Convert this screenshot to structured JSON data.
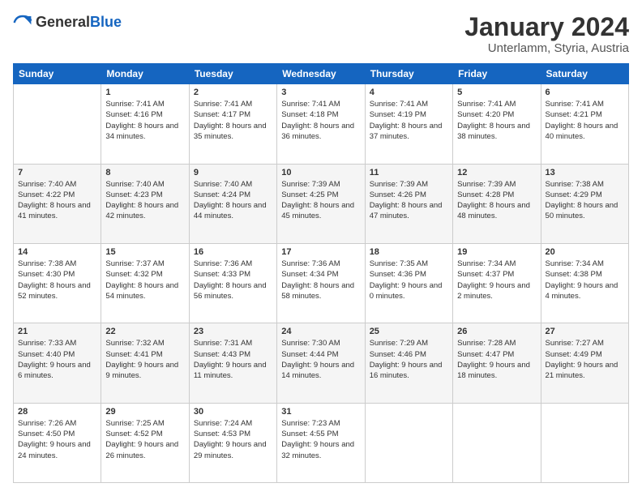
{
  "logo": {
    "general": "General",
    "blue": "Blue"
  },
  "header": {
    "title": "January 2024",
    "subtitle": "Unterlamm, Styria, Austria"
  },
  "weekdays": [
    "Sunday",
    "Monday",
    "Tuesday",
    "Wednesday",
    "Thursday",
    "Friday",
    "Saturday"
  ],
  "weeks": [
    [
      {
        "day": "",
        "sunrise": "",
        "sunset": "",
        "daylight": ""
      },
      {
        "day": "1",
        "sunrise": "Sunrise: 7:41 AM",
        "sunset": "Sunset: 4:16 PM",
        "daylight": "Daylight: 8 hours and 34 minutes."
      },
      {
        "day": "2",
        "sunrise": "Sunrise: 7:41 AM",
        "sunset": "Sunset: 4:17 PM",
        "daylight": "Daylight: 8 hours and 35 minutes."
      },
      {
        "day": "3",
        "sunrise": "Sunrise: 7:41 AM",
        "sunset": "Sunset: 4:18 PM",
        "daylight": "Daylight: 8 hours and 36 minutes."
      },
      {
        "day": "4",
        "sunrise": "Sunrise: 7:41 AM",
        "sunset": "Sunset: 4:19 PM",
        "daylight": "Daylight: 8 hours and 37 minutes."
      },
      {
        "day": "5",
        "sunrise": "Sunrise: 7:41 AM",
        "sunset": "Sunset: 4:20 PM",
        "daylight": "Daylight: 8 hours and 38 minutes."
      },
      {
        "day": "6",
        "sunrise": "Sunrise: 7:41 AM",
        "sunset": "Sunset: 4:21 PM",
        "daylight": "Daylight: 8 hours and 40 minutes."
      }
    ],
    [
      {
        "day": "7",
        "sunrise": "Sunrise: 7:40 AM",
        "sunset": "Sunset: 4:22 PM",
        "daylight": "Daylight: 8 hours and 41 minutes."
      },
      {
        "day": "8",
        "sunrise": "Sunrise: 7:40 AM",
        "sunset": "Sunset: 4:23 PM",
        "daylight": "Daylight: 8 hours and 42 minutes."
      },
      {
        "day": "9",
        "sunrise": "Sunrise: 7:40 AM",
        "sunset": "Sunset: 4:24 PM",
        "daylight": "Daylight: 8 hours and 44 minutes."
      },
      {
        "day": "10",
        "sunrise": "Sunrise: 7:39 AM",
        "sunset": "Sunset: 4:25 PM",
        "daylight": "Daylight: 8 hours and 45 minutes."
      },
      {
        "day": "11",
        "sunrise": "Sunrise: 7:39 AM",
        "sunset": "Sunset: 4:26 PM",
        "daylight": "Daylight: 8 hours and 47 minutes."
      },
      {
        "day": "12",
        "sunrise": "Sunrise: 7:39 AM",
        "sunset": "Sunset: 4:28 PM",
        "daylight": "Daylight: 8 hours and 48 minutes."
      },
      {
        "day": "13",
        "sunrise": "Sunrise: 7:38 AM",
        "sunset": "Sunset: 4:29 PM",
        "daylight": "Daylight: 8 hours and 50 minutes."
      }
    ],
    [
      {
        "day": "14",
        "sunrise": "Sunrise: 7:38 AM",
        "sunset": "Sunset: 4:30 PM",
        "daylight": "Daylight: 8 hours and 52 minutes."
      },
      {
        "day": "15",
        "sunrise": "Sunrise: 7:37 AM",
        "sunset": "Sunset: 4:32 PM",
        "daylight": "Daylight: 8 hours and 54 minutes."
      },
      {
        "day": "16",
        "sunrise": "Sunrise: 7:36 AM",
        "sunset": "Sunset: 4:33 PM",
        "daylight": "Daylight: 8 hours and 56 minutes."
      },
      {
        "day": "17",
        "sunrise": "Sunrise: 7:36 AM",
        "sunset": "Sunset: 4:34 PM",
        "daylight": "Daylight: 8 hours and 58 minutes."
      },
      {
        "day": "18",
        "sunrise": "Sunrise: 7:35 AM",
        "sunset": "Sunset: 4:36 PM",
        "daylight": "Daylight: 9 hours and 0 minutes."
      },
      {
        "day": "19",
        "sunrise": "Sunrise: 7:34 AM",
        "sunset": "Sunset: 4:37 PM",
        "daylight": "Daylight: 9 hours and 2 minutes."
      },
      {
        "day": "20",
        "sunrise": "Sunrise: 7:34 AM",
        "sunset": "Sunset: 4:38 PM",
        "daylight": "Daylight: 9 hours and 4 minutes."
      }
    ],
    [
      {
        "day": "21",
        "sunrise": "Sunrise: 7:33 AM",
        "sunset": "Sunset: 4:40 PM",
        "daylight": "Daylight: 9 hours and 6 minutes."
      },
      {
        "day": "22",
        "sunrise": "Sunrise: 7:32 AM",
        "sunset": "Sunset: 4:41 PM",
        "daylight": "Daylight: 9 hours and 9 minutes."
      },
      {
        "day": "23",
        "sunrise": "Sunrise: 7:31 AM",
        "sunset": "Sunset: 4:43 PM",
        "daylight": "Daylight: 9 hours and 11 minutes."
      },
      {
        "day": "24",
        "sunrise": "Sunrise: 7:30 AM",
        "sunset": "Sunset: 4:44 PM",
        "daylight": "Daylight: 9 hours and 14 minutes."
      },
      {
        "day": "25",
        "sunrise": "Sunrise: 7:29 AM",
        "sunset": "Sunset: 4:46 PM",
        "daylight": "Daylight: 9 hours and 16 minutes."
      },
      {
        "day": "26",
        "sunrise": "Sunrise: 7:28 AM",
        "sunset": "Sunset: 4:47 PM",
        "daylight": "Daylight: 9 hours and 18 minutes."
      },
      {
        "day": "27",
        "sunrise": "Sunrise: 7:27 AM",
        "sunset": "Sunset: 4:49 PM",
        "daylight": "Daylight: 9 hours and 21 minutes."
      }
    ],
    [
      {
        "day": "28",
        "sunrise": "Sunrise: 7:26 AM",
        "sunset": "Sunset: 4:50 PM",
        "daylight": "Daylight: 9 hours and 24 minutes."
      },
      {
        "day": "29",
        "sunrise": "Sunrise: 7:25 AM",
        "sunset": "Sunset: 4:52 PM",
        "daylight": "Daylight: 9 hours and 26 minutes."
      },
      {
        "day": "30",
        "sunrise": "Sunrise: 7:24 AM",
        "sunset": "Sunset: 4:53 PM",
        "daylight": "Daylight: 9 hours and 29 minutes."
      },
      {
        "day": "31",
        "sunrise": "Sunrise: 7:23 AM",
        "sunset": "Sunset: 4:55 PM",
        "daylight": "Daylight: 9 hours and 32 minutes."
      },
      {
        "day": "",
        "sunrise": "",
        "sunset": "",
        "daylight": ""
      },
      {
        "day": "",
        "sunrise": "",
        "sunset": "",
        "daylight": ""
      },
      {
        "day": "",
        "sunrise": "",
        "sunset": "",
        "daylight": ""
      }
    ]
  ]
}
